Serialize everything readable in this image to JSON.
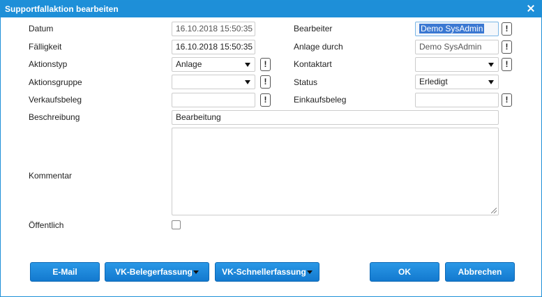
{
  "dialog": {
    "title": "Supportfallaktion bearbeiten",
    "close_icon": "close-icon"
  },
  "form": {
    "datum": {
      "label": "Datum",
      "value": "16.10.2018 15:50:35"
    },
    "faelligkeit": {
      "label": "Fälligkeit",
      "value": "16.10.2018 15:50:35"
    },
    "aktionstyp": {
      "label": "Aktionstyp",
      "value": "Anlage"
    },
    "aktionsgruppe": {
      "label": "Aktionsgruppe",
      "value": ""
    },
    "verkaufsbeleg": {
      "label": "Verkaufsbeleg",
      "value": ""
    },
    "beschreibung": {
      "label": "Beschreibung",
      "value": "Bearbeitung"
    },
    "kommentar": {
      "label": "Kommentar",
      "value": ""
    },
    "oeffentlich": {
      "label": "Öffentlich",
      "checked": false
    },
    "bearbeiter": {
      "label": "Bearbeiter",
      "value": "Demo SysAdmin"
    },
    "anlage_durch": {
      "label": "Anlage durch",
      "value": "Demo SysAdmin"
    },
    "kontaktart": {
      "label": "Kontaktart",
      "value": ""
    },
    "status": {
      "label": "Status",
      "value": "Erledigt"
    },
    "einkaufsbeleg": {
      "label": "Einkaufsbeleg",
      "value": ""
    },
    "info_button_label": "!"
  },
  "buttons": {
    "email": "E-Mail",
    "vk_belegerfassung": "VK-Belegerfassung",
    "vk_schnellerfassung": "VK-Schnellerfassung",
    "ok": "OK",
    "abbrechen": "Abbrechen"
  },
  "colors": {
    "titlebar": "#1e8fd8",
    "button": "#1a86db",
    "selection": "#3a78d2"
  }
}
